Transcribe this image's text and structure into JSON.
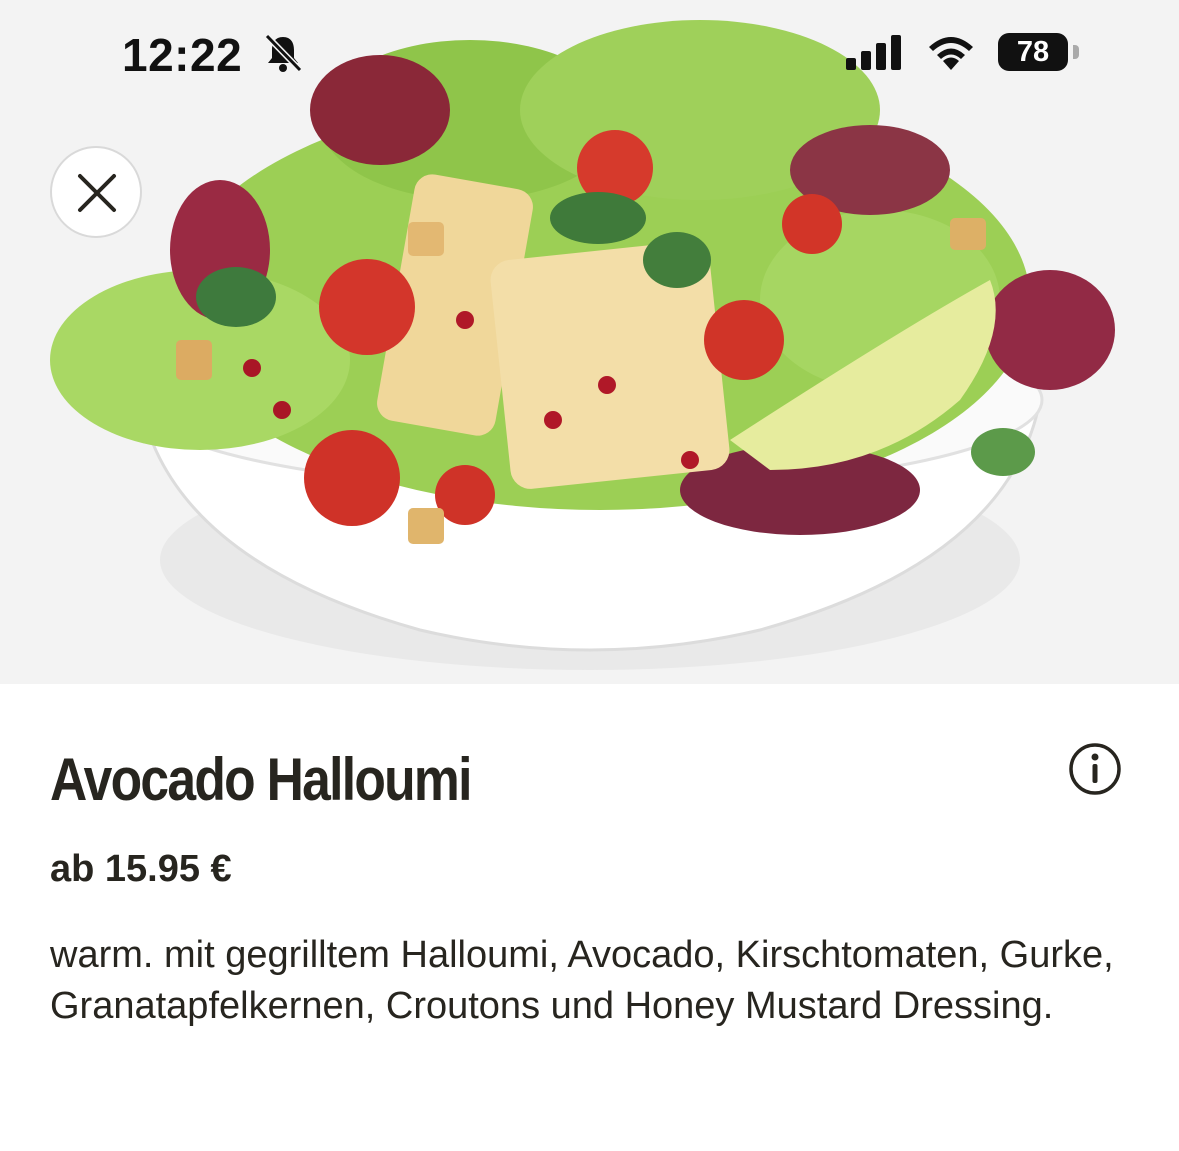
{
  "status_bar": {
    "time": "12:22",
    "battery_level": "78",
    "icons": [
      "bell-slash-icon",
      "cellular-signal-icon",
      "wifi-icon",
      "battery-icon"
    ]
  },
  "hero": {
    "image": "avocado-halloumi-salad-bowl",
    "close_icon": "close-icon"
  },
  "product": {
    "name": "Avocado Halloumi",
    "price": "ab 15.95 €",
    "description": "warm. mit gegrilltem Halloumi, Avocado, Kirschtomaten, Gurke, Granatapfelkernen, Croutons und Honey Mustard Dressing.",
    "info_icon": "info-icon"
  },
  "colors": {
    "text": "#27251f",
    "hero_background": "#f3f3f3",
    "page_background": "#ffffff"
  }
}
